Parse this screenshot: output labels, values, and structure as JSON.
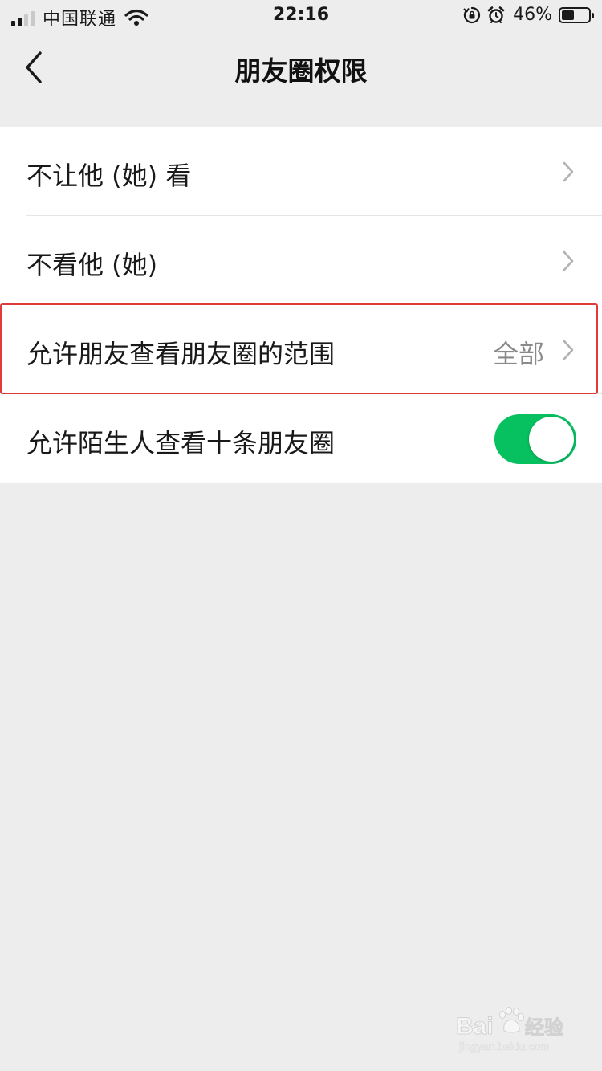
{
  "status_bar": {
    "carrier": "中国联通",
    "time": "22:16",
    "battery_percent": "46%",
    "battery_level": 0.46,
    "icons": [
      "signal-icon",
      "wifi-icon",
      "orientation-lock-icon",
      "alarm-icon",
      "battery-icon"
    ]
  },
  "nav": {
    "title": "朋友圈权限",
    "back_icon": "chevron-left-icon"
  },
  "settings": {
    "row1_label": "不让他 (她) 看",
    "row2_label": "不看他 (她)",
    "row3_label": "允许朋友查看朋友圈的范围",
    "row3_value": "全部",
    "row4_label": "允许陌生人查看十条朋友圈",
    "row4_enabled": true
  },
  "colors": {
    "background": "#ededed",
    "toggle_on": "#07c160",
    "highlight_border": "#e03a3a",
    "secondary_text": "#8a8a8a"
  }
}
